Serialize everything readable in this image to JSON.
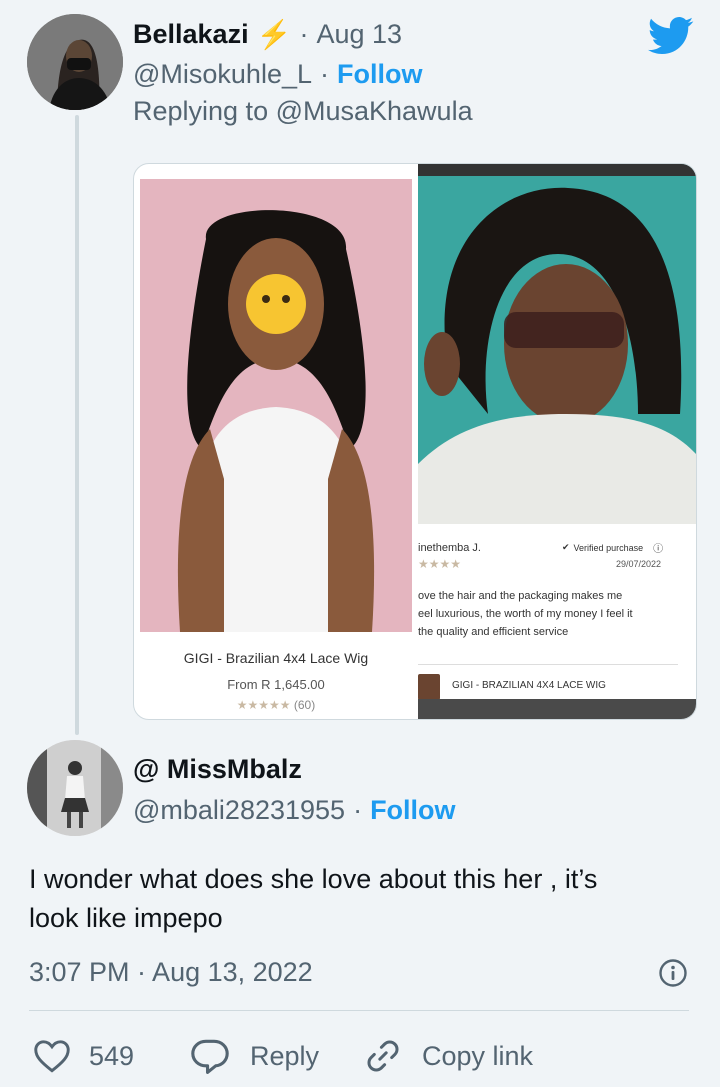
{
  "quoted": {
    "author_name": "Bellakazi",
    "author_emoji": "⚡",
    "separator": "·",
    "date": "Aug 13",
    "handle": "@Misokuhle_L",
    "follow_label": "Follow",
    "replying_to": "Replying to @MusaKhawula"
  },
  "card": {
    "left": {
      "product_name": "GIGI - Brazilian 4x4 Lace Wig",
      "price": "From R 1,645.00",
      "rating_count": "(60)",
      "rating_stars": 5
    },
    "right": {
      "reviewer": "inethemba J.",
      "verified_label": "Verified purchase",
      "review_date": "29/07/2022",
      "review_stars": 4,
      "review_line_1": "ove the hair and the packaging makes me",
      "review_line_2": "eel luxurious, the worth of my money I feel it",
      "review_line_3": "the quality and efficient service",
      "product_tag": "GIGI - BRAZILIAN 4X4 LACE WIG"
    }
  },
  "main": {
    "author_name": "@ MissMbalz",
    "handle": "@mbali28231955",
    "separator": "·",
    "follow_label": "Follow",
    "text_line_1": "I wonder what does she love about this her , it’s",
    "text_line_2": "look like impepo",
    "timestamp": "3:07 PM · Aug 13, 2022"
  },
  "footer": {
    "like_count": "549",
    "reply_label": "Reply",
    "copy_link_label": "Copy link"
  },
  "colors": {
    "accent": "#1d9bf0",
    "background": "#f0f4f7",
    "muted_text": "#536471"
  }
}
